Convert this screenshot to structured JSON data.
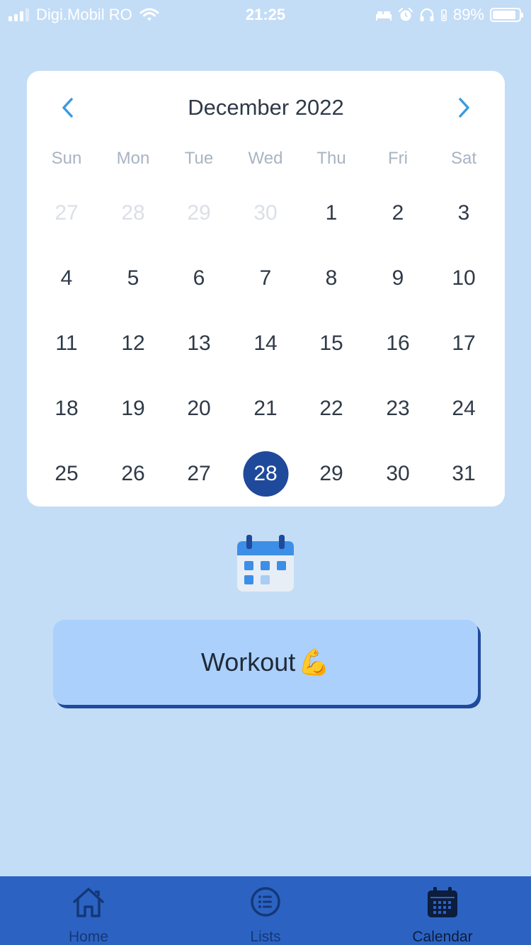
{
  "status_bar": {
    "carrier": "Digi.Mobil RO",
    "time": "21:25",
    "battery": "89%",
    "battery_level": 0.89,
    "icons": [
      "signal-icon",
      "wifi-icon",
      "bed-icon",
      "alarm-icon",
      "headphones-icon",
      "battery-icon"
    ]
  },
  "calendar": {
    "month_title": "December 2022",
    "prev_icon": "chevron-left-icon",
    "next_icon": "chevron-right-icon",
    "weekdays": [
      "Sun",
      "Mon",
      "Tue",
      "Wed",
      "Thu",
      "Fri",
      "Sat"
    ],
    "weeks": [
      [
        {
          "d": "27",
          "muted": true
        },
        {
          "d": "28",
          "muted": true
        },
        {
          "d": "29",
          "muted": true
        },
        {
          "d": "30",
          "muted": true
        },
        {
          "d": "1"
        },
        {
          "d": "2"
        },
        {
          "d": "3"
        }
      ],
      [
        {
          "d": "4"
        },
        {
          "d": "5"
        },
        {
          "d": "6"
        },
        {
          "d": "7"
        },
        {
          "d": "8"
        },
        {
          "d": "9"
        },
        {
          "d": "10"
        }
      ],
      [
        {
          "d": "11"
        },
        {
          "d": "12"
        },
        {
          "d": "13"
        },
        {
          "d": "14"
        },
        {
          "d": "15"
        },
        {
          "d": "16"
        },
        {
          "d": "17"
        }
      ],
      [
        {
          "d": "18"
        },
        {
          "d": "19"
        },
        {
          "d": "20"
        },
        {
          "d": "21"
        },
        {
          "d": "22"
        },
        {
          "d": "23"
        },
        {
          "d": "24"
        }
      ],
      [
        {
          "d": "25"
        },
        {
          "d": "26"
        },
        {
          "d": "27"
        },
        {
          "d": "28",
          "selected": true
        },
        {
          "d": "29"
        },
        {
          "d": "30"
        },
        {
          "d": "31"
        }
      ]
    ],
    "selected_day": "28",
    "colors": {
      "accent_nav": "#3a9be0",
      "selected_bg": "#1f4a9b"
    }
  },
  "event_icon": "calendar-icon",
  "workout": {
    "label": "Workout",
    "emoji": "💪"
  },
  "tab_bar": {
    "tabs": [
      {
        "label": "Home",
        "icon": "home-icon"
      },
      {
        "label": "Lists",
        "icon": "list-icon"
      },
      {
        "label": "Calendar",
        "icon": "calendar-icon",
        "active": true
      }
    ]
  },
  "colors": {
    "background": "#c4ddf6",
    "tab_bar": "#2c63c2",
    "button": "#abd0fb"
  }
}
